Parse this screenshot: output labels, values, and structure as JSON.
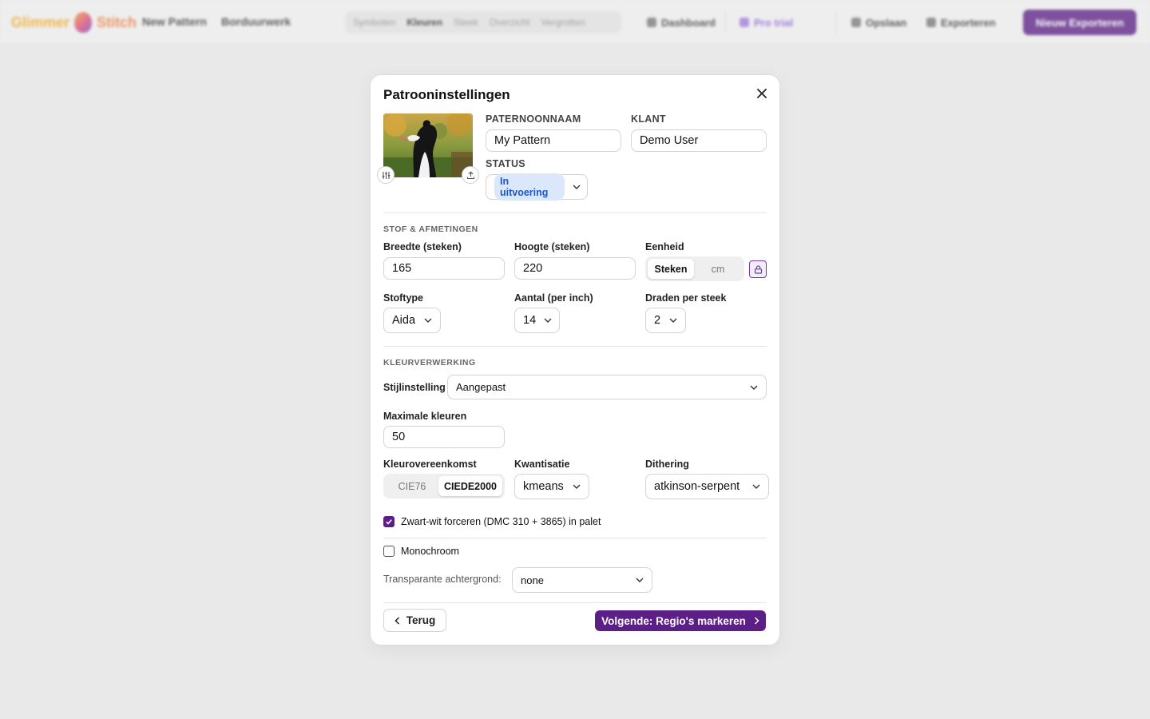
{
  "colors": {
    "accent": "#5b1f86",
    "badge_bg": "#dbe8fb",
    "badge_text": "#1e56c8",
    "backdrop": "#e9e9e9"
  },
  "topbar": {
    "logo_part1": "Glimmer",
    "logo_part2": "Stitch",
    "nav": [
      "New Pattern",
      "Borduurwerk"
    ],
    "segments": [
      "Symbolen",
      "Kleuren",
      "Steek",
      "Overzicht",
      "Vergrotten"
    ],
    "dashboard": "Dashboard",
    "pro_label": "Pro trial",
    "account": "Opslaan",
    "export": "Exporteren",
    "cta": "Nieuw Exporteren"
  },
  "modal": {
    "title": "Patrooninstellingen",
    "pattern_name_label": "PATERNOONNAAM",
    "pattern_name_value": "My Pattern",
    "client_label": "KLANT",
    "client_value": "Demo User",
    "status_label": "STATUS",
    "status_value": "In uitvoering",
    "section_fabric": "STOF & AFMETINGEN",
    "width_label": "Breedte (steken)",
    "width_value": "165",
    "height_label": "Hoogte (steken)",
    "height_value": "220",
    "unit_label": "Eenheid",
    "unit_options": [
      "Steken",
      "cm"
    ],
    "unit_selected": "Steken",
    "fabric_label": "Stoftype",
    "fabric_value": "Aida",
    "count_label": "Aantal (per inch)",
    "count_value": "14",
    "strands_label": "Draden per steek",
    "strands_value": "2",
    "section_color": "KLEURVERWERKING",
    "style_label": "Stijlinstelling",
    "style_value": "Aangepast",
    "max_colors_label": "Maximale kleuren",
    "max_colors_value": "50",
    "color_match_label": "Kleurovereenkomst",
    "color_match_options": [
      "CIE76",
      "CIEDE2000"
    ],
    "color_match_selected": "CIEDE2000",
    "quant_label": "Kwantisatie",
    "quant_value": "kmeans",
    "dither_label": "Dithering",
    "dither_value": "atkinson-serpent",
    "force_bw_label": "Zwart-wit forceren (DMC 310 + 3865) in palet",
    "force_bw_checked": true,
    "mono_label": "Monochroom",
    "mono_checked": false,
    "transparent_label": "Transparante achtergrond:",
    "transparent_value": "none",
    "back_label": "Terug",
    "next_label": "Volgende: Regio's markeren"
  }
}
